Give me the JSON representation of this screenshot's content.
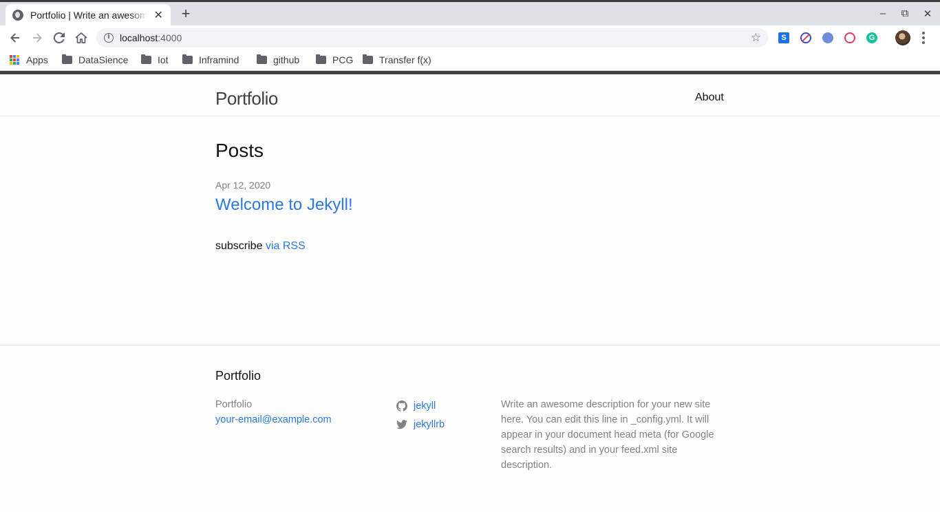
{
  "browser": {
    "tab": {
      "title": "Portfolio | Write an awesome description for your new site",
      "close": "✕"
    },
    "newtab": "+",
    "window": {
      "minimize": "–",
      "restore": "⧉",
      "close": "✕"
    },
    "url": {
      "host": "localhost",
      "port": ":4000"
    },
    "bookmarks": [
      {
        "label": "Apps",
        "icon": "apps-grid-icon"
      },
      {
        "label": "DataSience",
        "icon": "folder-icon"
      },
      {
        "label": "Iot",
        "icon": "folder-icon"
      },
      {
        "label": "Inframind",
        "icon": "folder-icon"
      },
      {
        "label": "github",
        "icon": "folder-icon"
      },
      {
        "label": "PCG",
        "icon": "folder-icon"
      },
      {
        "label": "Transfer f(x)",
        "icon": "folder-icon"
      }
    ],
    "extensions": [
      {
        "name": "s-extension-icon",
        "color": "#1a73e8"
      },
      {
        "name": "block-extension-icon",
        "color": "#3c4bc7"
      },
      {
        "name": "leaf-extension-icon",
        "color": "#6d8fd8"
      },
      {
        "name": "spiral-extension-icon",
        "color": "#e8395a"
      },
      {
        "name": "grammarly-icon",
        "color": "#15c39a"
      }
    ]
  },
  "site": {
    "title": "Portfolio",
    "nav": {
      "about": "About"
    },
    "posts_heading": "Posts",
    "posts": [
      {
        "date": "Apr 12, 2020",
        "title": "Welcome to Jekyll!"
      }
    ],
    "rss": {
      "prefix": "subscribe",
      "link": "via RSS"
    },
    "footer": {
      "heading": "Portfolio",
      "name": "Portfolio",
      "email": "your-email@example.com",
      "github": "jekyll",
      "twitter": "jekyllrb",
      "description": "Write an awesome description for your new site here. You can edit this line in _config.yml. It will appear in your document head meta (for Google search results) and in your feed.xml site description."
    }
  },
  "colors": {
    "link": "#2a7ae2",
    "text": "#111111",
    "muted": "#828282",
    "header_border": "#424242"
  }
}
